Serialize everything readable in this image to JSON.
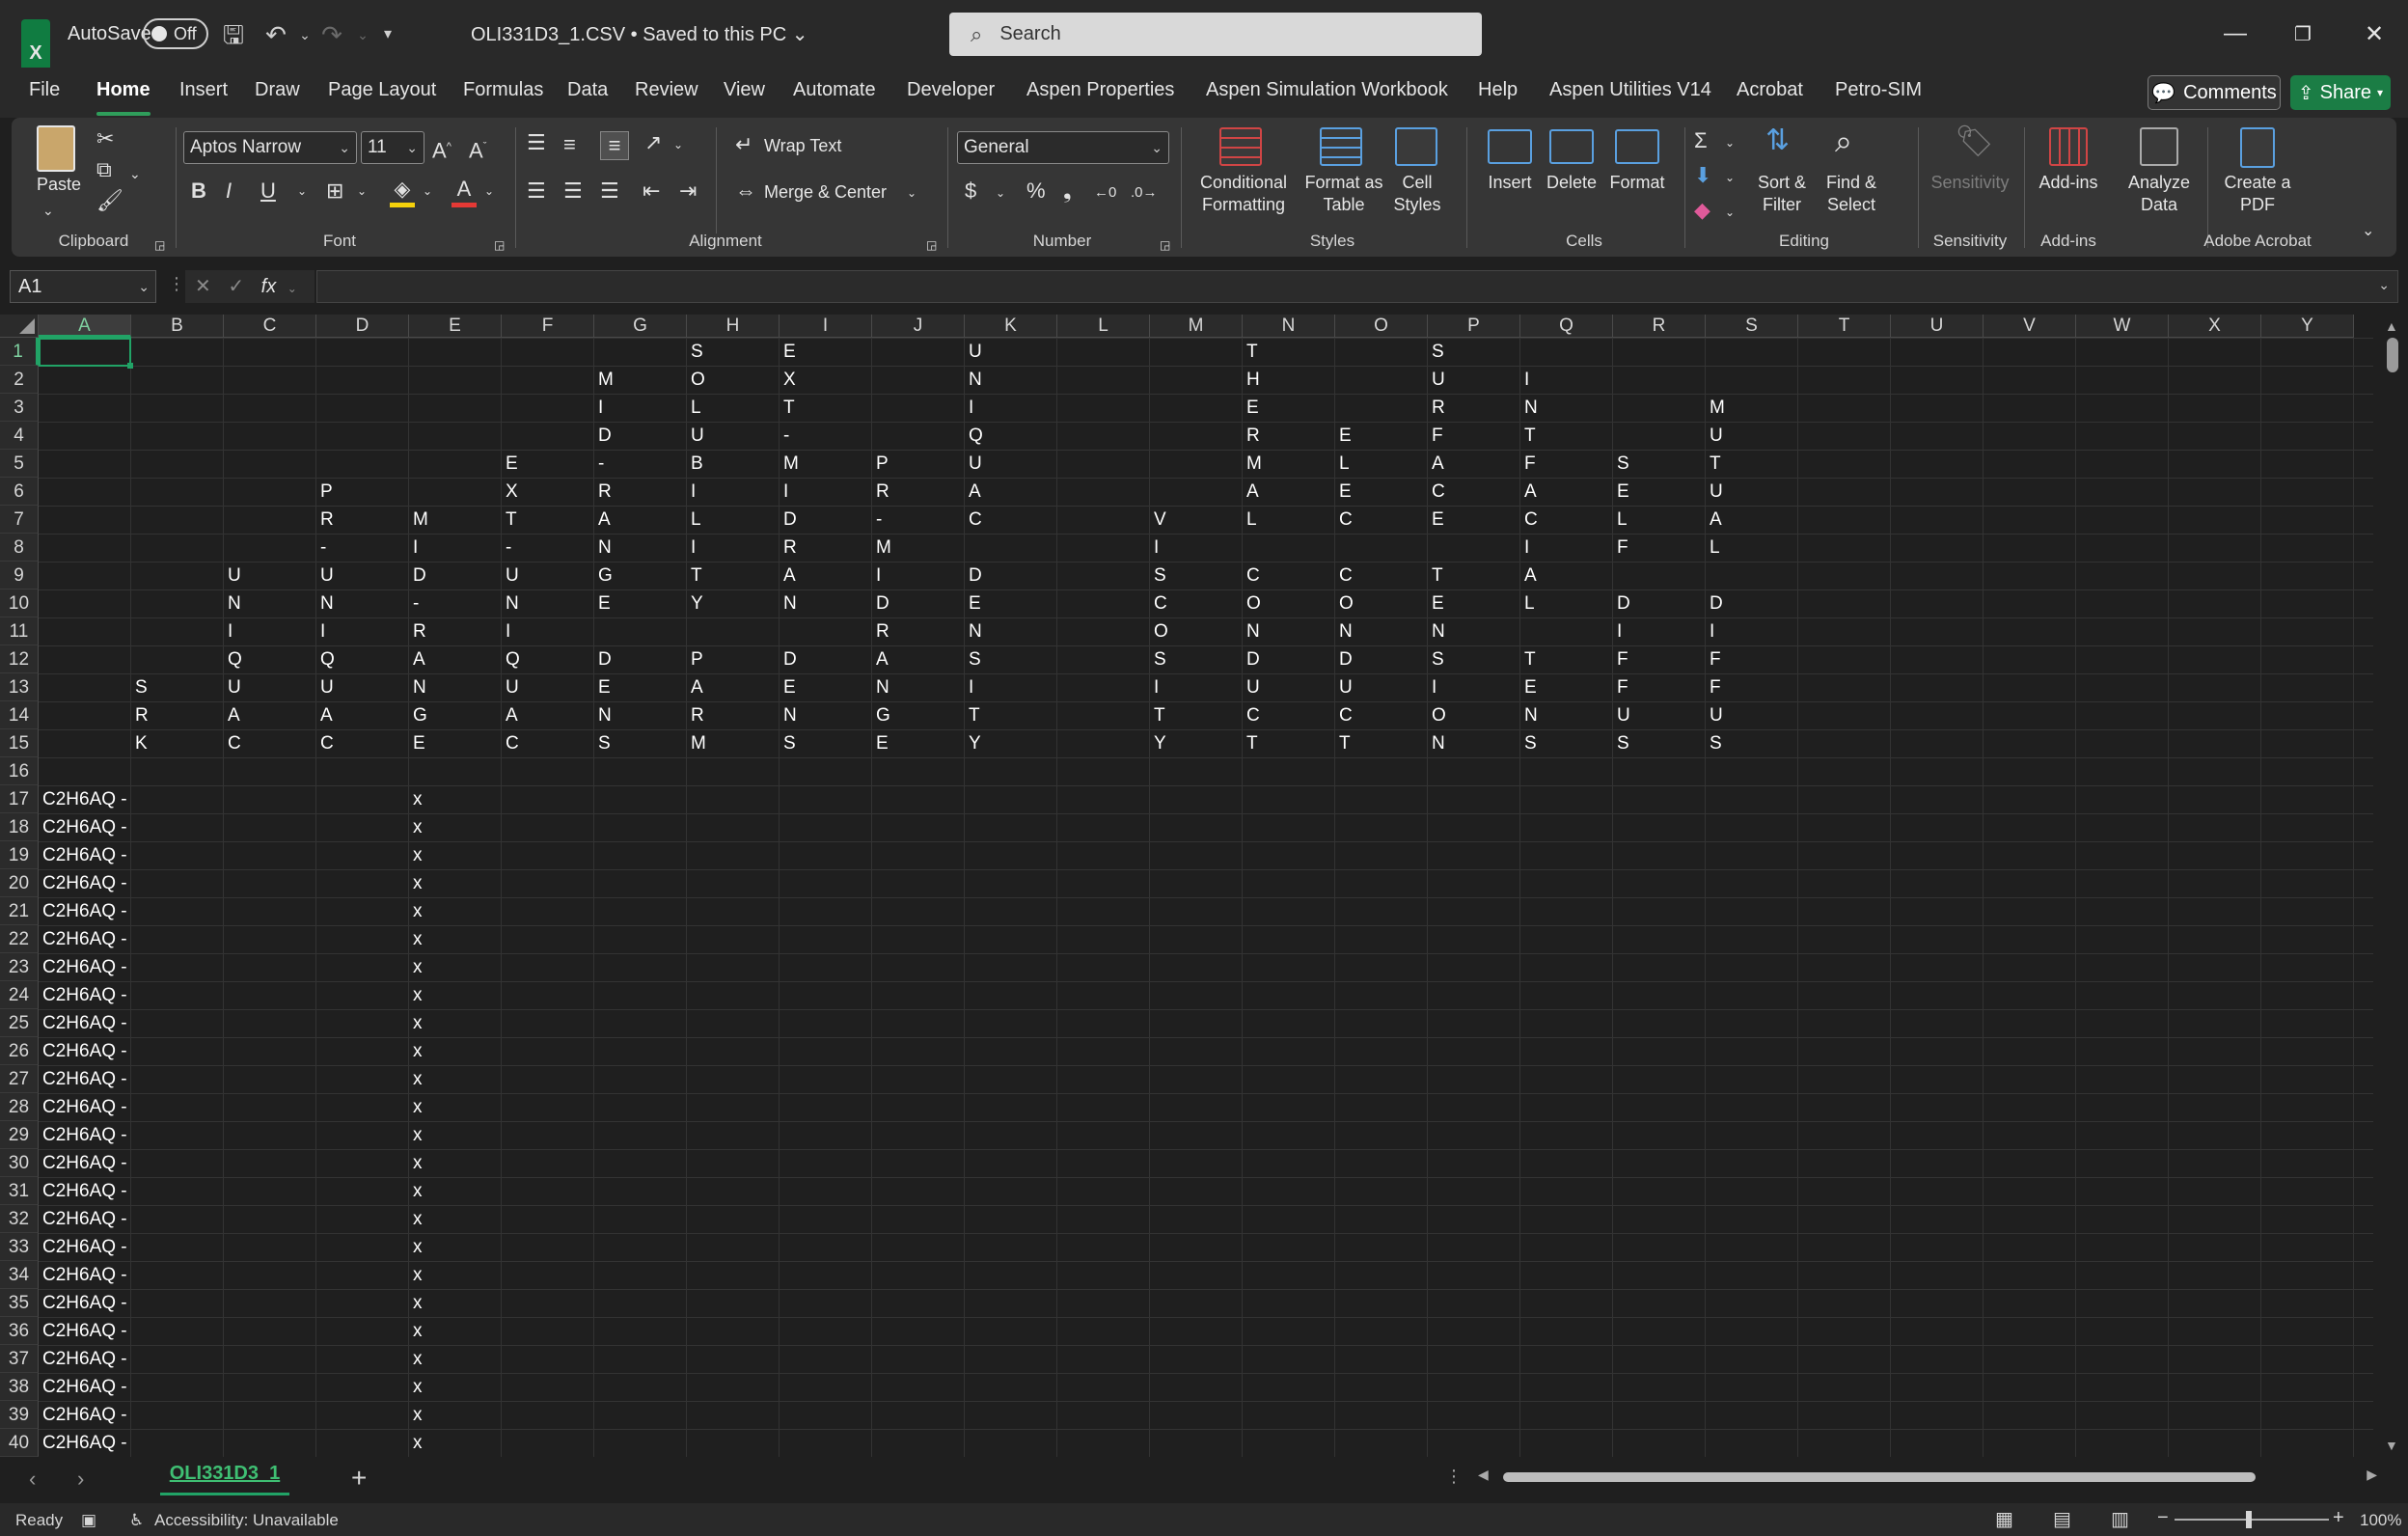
{
  "titlebar": {
    "autosave_label": "AutoSave",
    "autosave_state": "Off",
    "file_title": "OLI331D3_1.CSV • Saved to this PC ⌄",
    "search_placeholder": "Search"
  },
  "menu": [
    "File",
    "Home",
    "Insert",
    "Draw",
    "Page Layout",
    "Formulas",
    "Data",
    "Review",
    "View",
    "Automate",
    "Developer",
    "Aspen Properties",
    "Aspen Simulation Workbook",
    "Help",
    "Aspen Utilities V14",
    "Acrobat",
    "Petro-SIM"
  ],
  "menu_active": "Home",
  "comments_label": "Comments",
  "share_label": "Share",
  "ribbon": {
    "paste": "Paste",
    "font_name": "Aptos Narrow",
    "font_size": "11",
    "wrap_text": "Wrap Text",
    "merge_center": "Merge & Center",
    "number_format": "General",
    "conditional_formatting": "Conditional Formatting",
    "format_as_table": "Format as Table",
    "cell_styles": "Cell Styles",
    "insert": "Insert",
    "delete": "Delete",
    "format": "Format",
    "sort_filter": "Sort & Filter",
    "find_select": "Find & Select",
    "sensitivity": "Sensitivity",
    "add_ins": "Add-ins",
    "analyze_data": "Analyze Data",
    "create_pdf": "Create a PDF",
    "groups": {
      "clipboard": "Clipboard",
      "font": "Font",
      "alignment": "Alignment",
      "number": "Number",
      "styles": "Styles",
      "cells": "Cells",
      "editing": "Editing",
      "sensitivity": "Sensitivity",
      "addins": "Add-ins",
      "adobe": "Adobe Acrobat"
    }
  },
  "namebox": "A1",
  "columns": [
    "A",
    "B",
    "C",
    "D",
    "E",
    "F",
    "G",
    "H",
    "I",
    "J",
    "K",
    "L",
    "M",
    "N",
    "O",
    "P",
    "Q",
    "R",
    "S",
    "T",
    "U",
    "V",
    "W",
    "X",
    "Y"
  ],
  "rows": [
    "1",
    "2",
    "3",
    "4",
    "5",
    "6",
    "7",
    "8",
    "9",
    "10",
    "11",
    "12",
    "13",
    "14",
    "15",
    "16",
    "17",
    "18",
    "19",
    "20",
    "21",
    "22",
    "23",
    "24",
    "25",
    "26",
    "27",
    "28",
    "29",
    "30",
    "31",
    "32",
    "33",
    "34",
    "35",
    "36",
    "37",
    "38",
    "39",
    "40"
  ],
  "grid": [
    [
      "",
      "",
      "",
      "",
      "",
      "",
      "",
      "S",
      "E",
      "",
      "U",
      "",
      "",
      "T",
      "",
      "S",
      "",
      "",
      ""
    ],
    [
      "",
      "",
      "",
      "",
      "",
      "",
      "M",
      "O",
      "X",
      "",
      "N",
      "",
      "",
      "H",
      "",
      "U",
      "I",
      "",
      ""
    ],
    [
      "",
      "",
      "",
      "",
      "",
      "",
      "I",
      "L",
      "T",
      "",
      "I",
      "",
      "",
      "E",
      "",
      "R",
      "N",
      "",
      "M"
    ],
    [
      "",
      "",
      "",
      "",
      "",
      "",
      "D",
      "U",
      "-",
      "",
      "Q",
      "",
      "",
      "R",
      "E",
      "F",
      "T",
      "",
      "U"
    ],
    [
      "",
      "",
      "",
      "",
      "",
      "E",
      "-",
      "B",
      "M",
      "P",
      "U",
      "",
      "",
      "M",
      "L",
      "A",
      "F",
      "S",
      "T"
    ],
    [
      "",
      "",
      "",
      "P",
      "",
      "X",
      "R",
      "I",
      "I",
      "R",
      "A",
      "",
      "",
      "A",
      "E",
      "C",
      "A",
      "E",
      "U"
    ],
    [
      "",
      "",
      "",
      "R",
      "M",
      "T",
      "A",
      "L",
      "D",
      "-",
      "C",
      "",
      "V",
      "L",
      "C",
      "E",
      "C",
      "L",
      "A"
    ],
    [
      "",
      "",
      "",
      "-",
      "I",
      "-",
      "N",
      "I",
      "R",
      "M",
      "",
      "",
      "I",
      "",
      "",
      "",
      "I",
      "F",
      "L"
    ],
    [
      "",
      "",
      "U",
      "U",
      "D",
      "U",
      "G",
      "T",
      "A",
      "I",
      "D",
      "",
      "S",
      "C",
      "C",
      "T",
      "A",
      "",
      ""
    ],
    [
      "",
      "",
      "N",
      "N",
      "-",
      "N",
      "E",
      "Y",
      "N",
      "D",
      "E",
      "",
      "C",
      "O",
      "O",
      "E",
      "L",
      "D",
      "D"
    ],
    [
      "",
      "",
      "I",
      "I",
      "R",
      "I",
      "",
      "",
      "",
      "R",
      "N",
      "",
      "O",
      "N",
      "N",
      "N",
      "",
      "I",
      "I"
    ],
    [
      "",
      "",
      "Q",
      "Q",
      "A",
      "Q",
      "D",
      "P",
      "D",
      "A",
      "S",
      "",
      "S",
      "D",
      "D",
      "S",
      "T",
      "F",
      "F"
    ],
    [
      "",
      "S",
      "U",
      "U",
      "N",
      "U",
      "E",
      "A",
      "E",
      "N",
      "I",
      "",
      "I",
      "U",
      "U",
      "I",
      "E",
      "F",
      "F"
    ],
    [
      "",
      "R",
      "A",
      "A",
      "G",
      "A",
      "N",
      "R",
      "N",
      "G",
      "T",
      "",
      "T",
      "C",
      "C",
      "O",
      "N",
      "U",
      "U"
    ],
    [
      "",
      "K",
      "C",
      "C",
      "E",
      "C",
      "S",
      "M",
      "S",
      "E",
      "Y",
      "",
      "Y",
      "T",
      "T",
      "N",
      "S",
      "S",
      "S"
    ],
    [
      "",
      "",
      "",
      "",
      "",
      "",
      "",
      "",
      "",
      "",
      "",
      "",
      "",
      "",
      "",
      "",
      "",
      "",
      ""
    ]
  ],
  "data_rows": {
    "col_a": "C2H6AQ -",
    "col_e": "x",
    "count": 24
  },
  "sheet_tab": "OLI331D3_1",
  "status": {
    "ready": "Ready",
    "accessibility": "Accessibility: Unavailable",
    "zoom": "100%"
  }
}
